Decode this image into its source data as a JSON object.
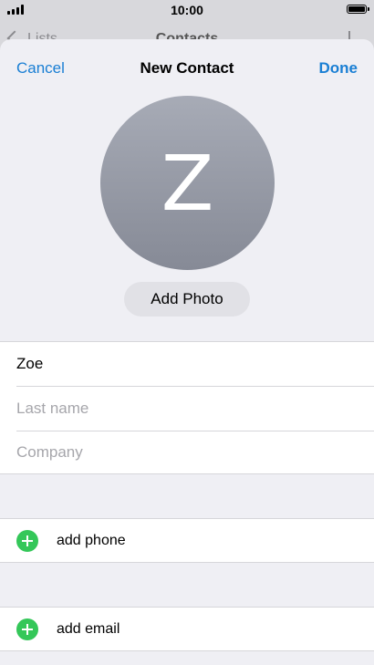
{
  "status_bar": {
    "time": "10:00"
  },
  "back_screen": {
    "back_label": "Lists",
    "title": "Contacts"
  },
  "nav": {
    "cancel_label": "Cancel",
    "title": "New Contact",
    "done_label": "Done"
  },
  "avatar": {
    "initial": "Z"
  },
  "add_photo_label": "Add Photo",
  "fields": {
    "first_name_value": "Zoe",
    "last_name_placeholder": "Last name",
    "company_placeholder": "Company"
  },
  "rows": {
    "add_phone_label": "add phone",
    "add_email_label": "add email"
  },
  "colors": {
    "accent": "#1a7fd4",
    "add_icon": "#34c759",
    "background": "#efeff4"
  }
}
